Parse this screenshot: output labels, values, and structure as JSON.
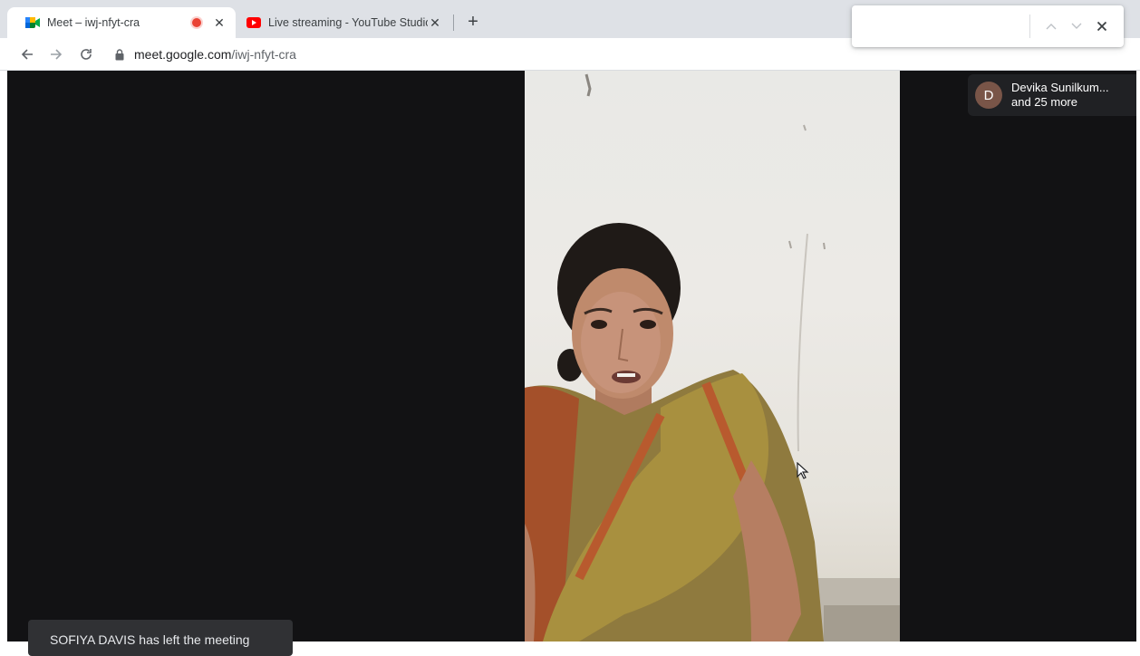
{
  "browser": {
    "tabs": [
      {
        "title": "Meet – iwj-nfyt-cra",
        "favicon": "google-meet-icon",
        "recording": true,
        "active": true
      },
      {
        "title": "Live streaming - YouTube Studio",
        "favicon": "youtube-icon",
        "active": false
      }
    ],
    "close_glyph": "✕",
    "new_tab_glyph": "+",
    "url": {
      "host": "meet.google.com",
      "path": "/iwj-nfyt-cra"
    },
    "find_bar": {
      "value": ""
    }
  },
  "meet": {
    "participants": {
      "avatar_initial": "D",
      "name": "Devika Sunilkum...",
      "more": "and 25 more"
    },
    "toast": "SOFIYA DAVIS has left the meeting"
  },
  "colors": {
    "stage_bg": "#121214",
    "recording": "#ea4335",
    "youtube": "#ff0000",
    "avatar": "#795548"
  }
}
